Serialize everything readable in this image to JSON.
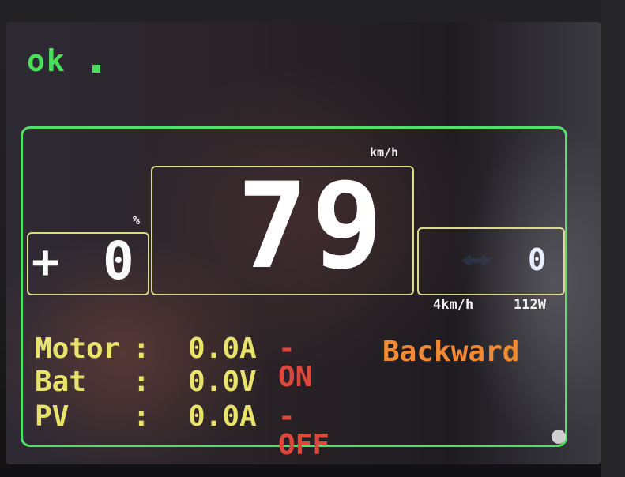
{
  "status": {
    "text": "ok"
  },
  "left_panel": {
    "unit": "%",
    "sign": "+",
    "value": "0"
  },
  "center_panel": {
    "unit": "km/h",
    "speed": "79"
  },
  "right_panel": {
    "value": "0",
    "speed_label": "4km/h",
    "power_label": "112W"
  },
  "readouts": {
    "motor": {
      "label": "Motor",
      "colon": ":",
      "value": "0.0A",
      "state": "-ON"
    },
    "battery": {
      "label": "Bat",
      "colon": ":",
      "value": "0.0V"
    },
    "pv": {
      "label": "PV",
      "colon": ":",
      "value": "0.0A",
      "state": "-OFF"
    },
    "direction": "Backward"
  },
  "colors": {
    "frame": "#52e06a",
    "box_border": "#d8dc8a",
    "status": "#4ade5a",
    "readout": "#e8e36a",
    "state": "#e0463c",
    "direction": "#f08a35"
  }
}
